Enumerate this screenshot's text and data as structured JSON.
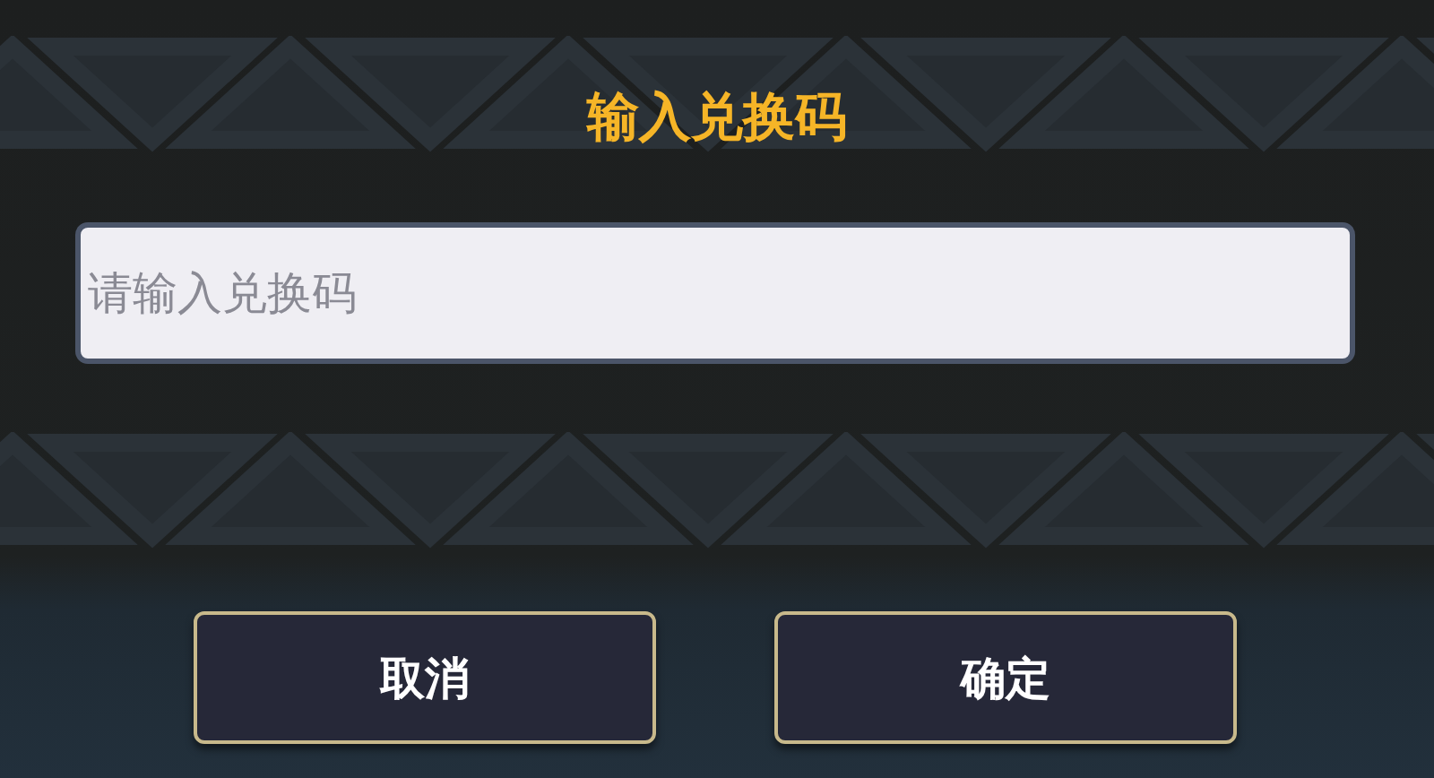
{
  "dialog": {
    "title": "输入兑换码"
  },
  "code_field": {
    "placeholder": "请输入兑换码"
  },
  "buttons": [
    {
      "label": "取消"
    },
    {
      "label": "确定"
    }
  ]
}
